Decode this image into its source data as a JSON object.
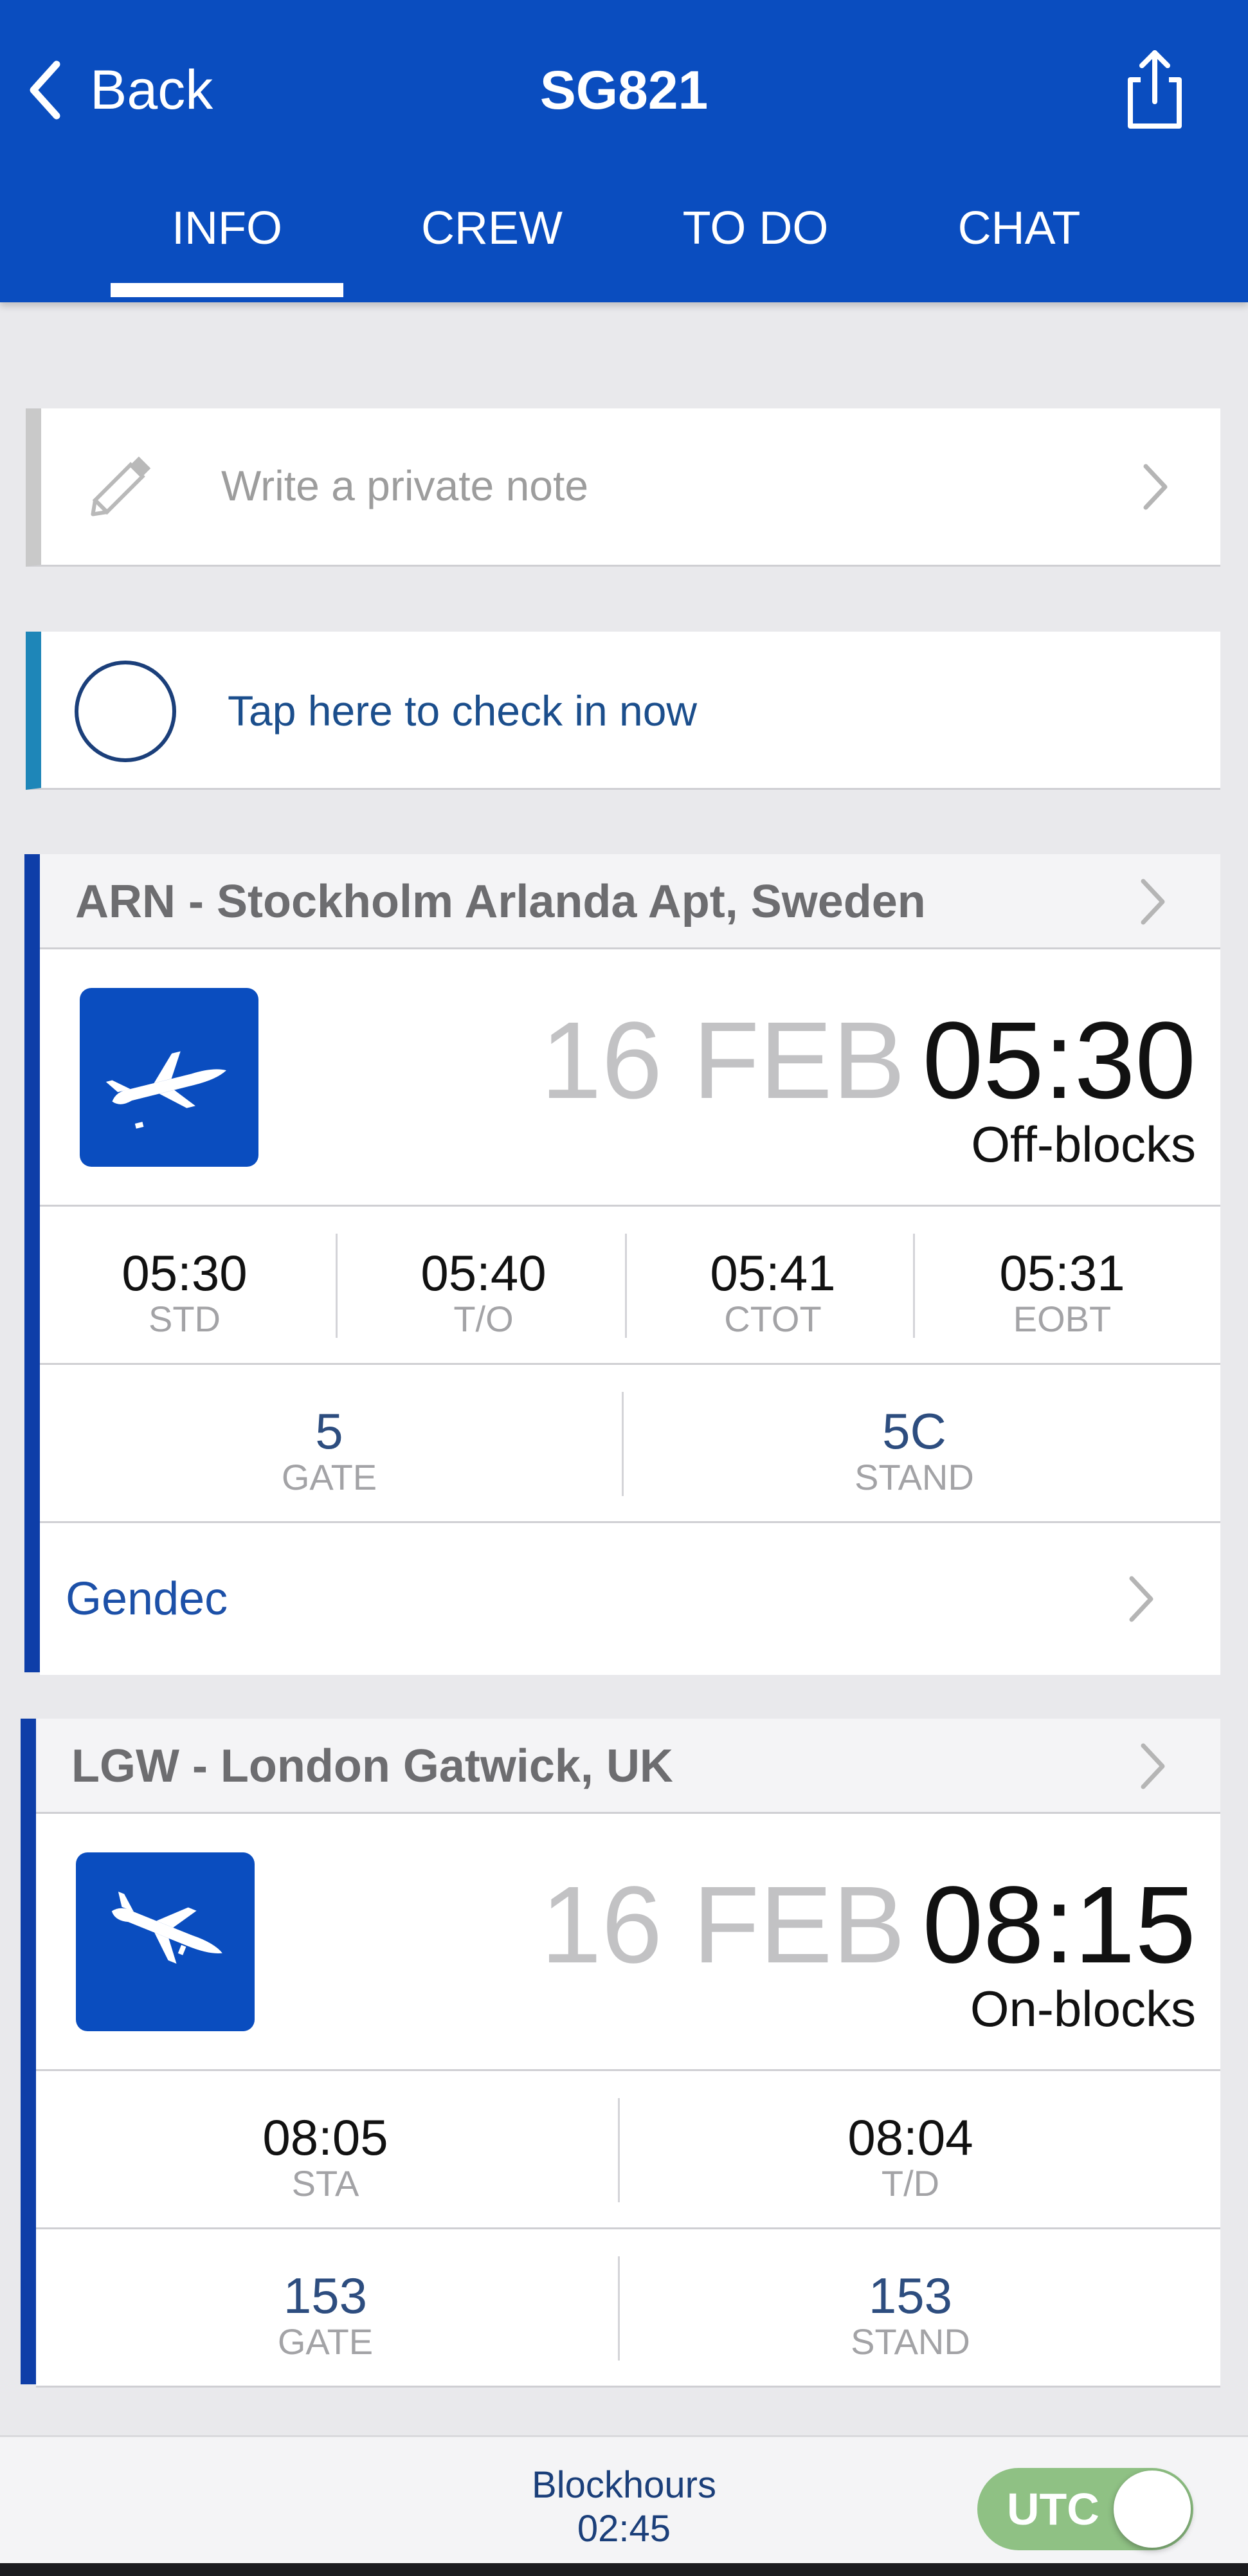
{
  "header": {
    "back_label": "Back",
    "title": "SG821",
    "tabs": [
      {
        "label": "INFO",
        "active": true
      },
      {
        "label": "CREW",
        "active": false
      },
      {
        "label": "TO DO",
        "active": false
      },
      {
        "label": "CHAT",
        "active": false
      }
    ],
    "icons": {
      "back": "chevron-left-icon",
      "share": "share-icon"
    }
  },
  "note": {
    "placeholder": "Write a private note",
    "icon": "pencil-icon"
  },
  "checkin": {
    "label": "Tap here to check in now",
    "icon": "circle-check-icon"
  },
  "departure": {
    "route": "ARN - Stockholm Arlanda Apt, Sweden",
    "icon": "takeoff-icon",
    "date": "16 FEB",
    "time": "05:30",
    "blocks_label": "Off-blocks",
    "times": [
      {
        "value": "05:30",
        "label": "STD"
      },
      {
        "value": "05:40",
        "label": "T/O"
      },
      {
        "value": "05:41",
        "label": "CTOT"
      },
      {
        "value": "05:31",
        "label": "EOBT"
      }
    ],
    "gate": {
      "value": "5",
      "label": "GATE"
    },
    "stand": {
      "value": "5C",
      "label": "STAND"
    },
    "gendec_label": "Gendec"
  },
  "arrival": {
    "route": "LGW - London Gatwick, UK",
    "icon": "landing-icon",
    "date": "16 FEB",
    "time": "08:15",
    "blocks_label": "On-blocks",
    "times": [
      {
        "value": "08:05",
        "label": "STA"
      },
      {
        "value": "08:04",
        "label": "T/D"
      }
    ],
    "gate": {
      "value": "153",
      "label": "GATE"
    },
    "stand": {
      "value": "153",
      "label": "STAND"
    }
  },
  "footer": {
    "blockhours_label": "Blockhours",
    "blockhours_value": "02:45",
    "utc_label": "UTC",
    "utc_enabled": true
  },
  "colors": {
    "brand_blue": "#0a4dbf",
    "accent_teal": "#1e86b8",
    "toggle_green": "#8fc184"
  }
}
